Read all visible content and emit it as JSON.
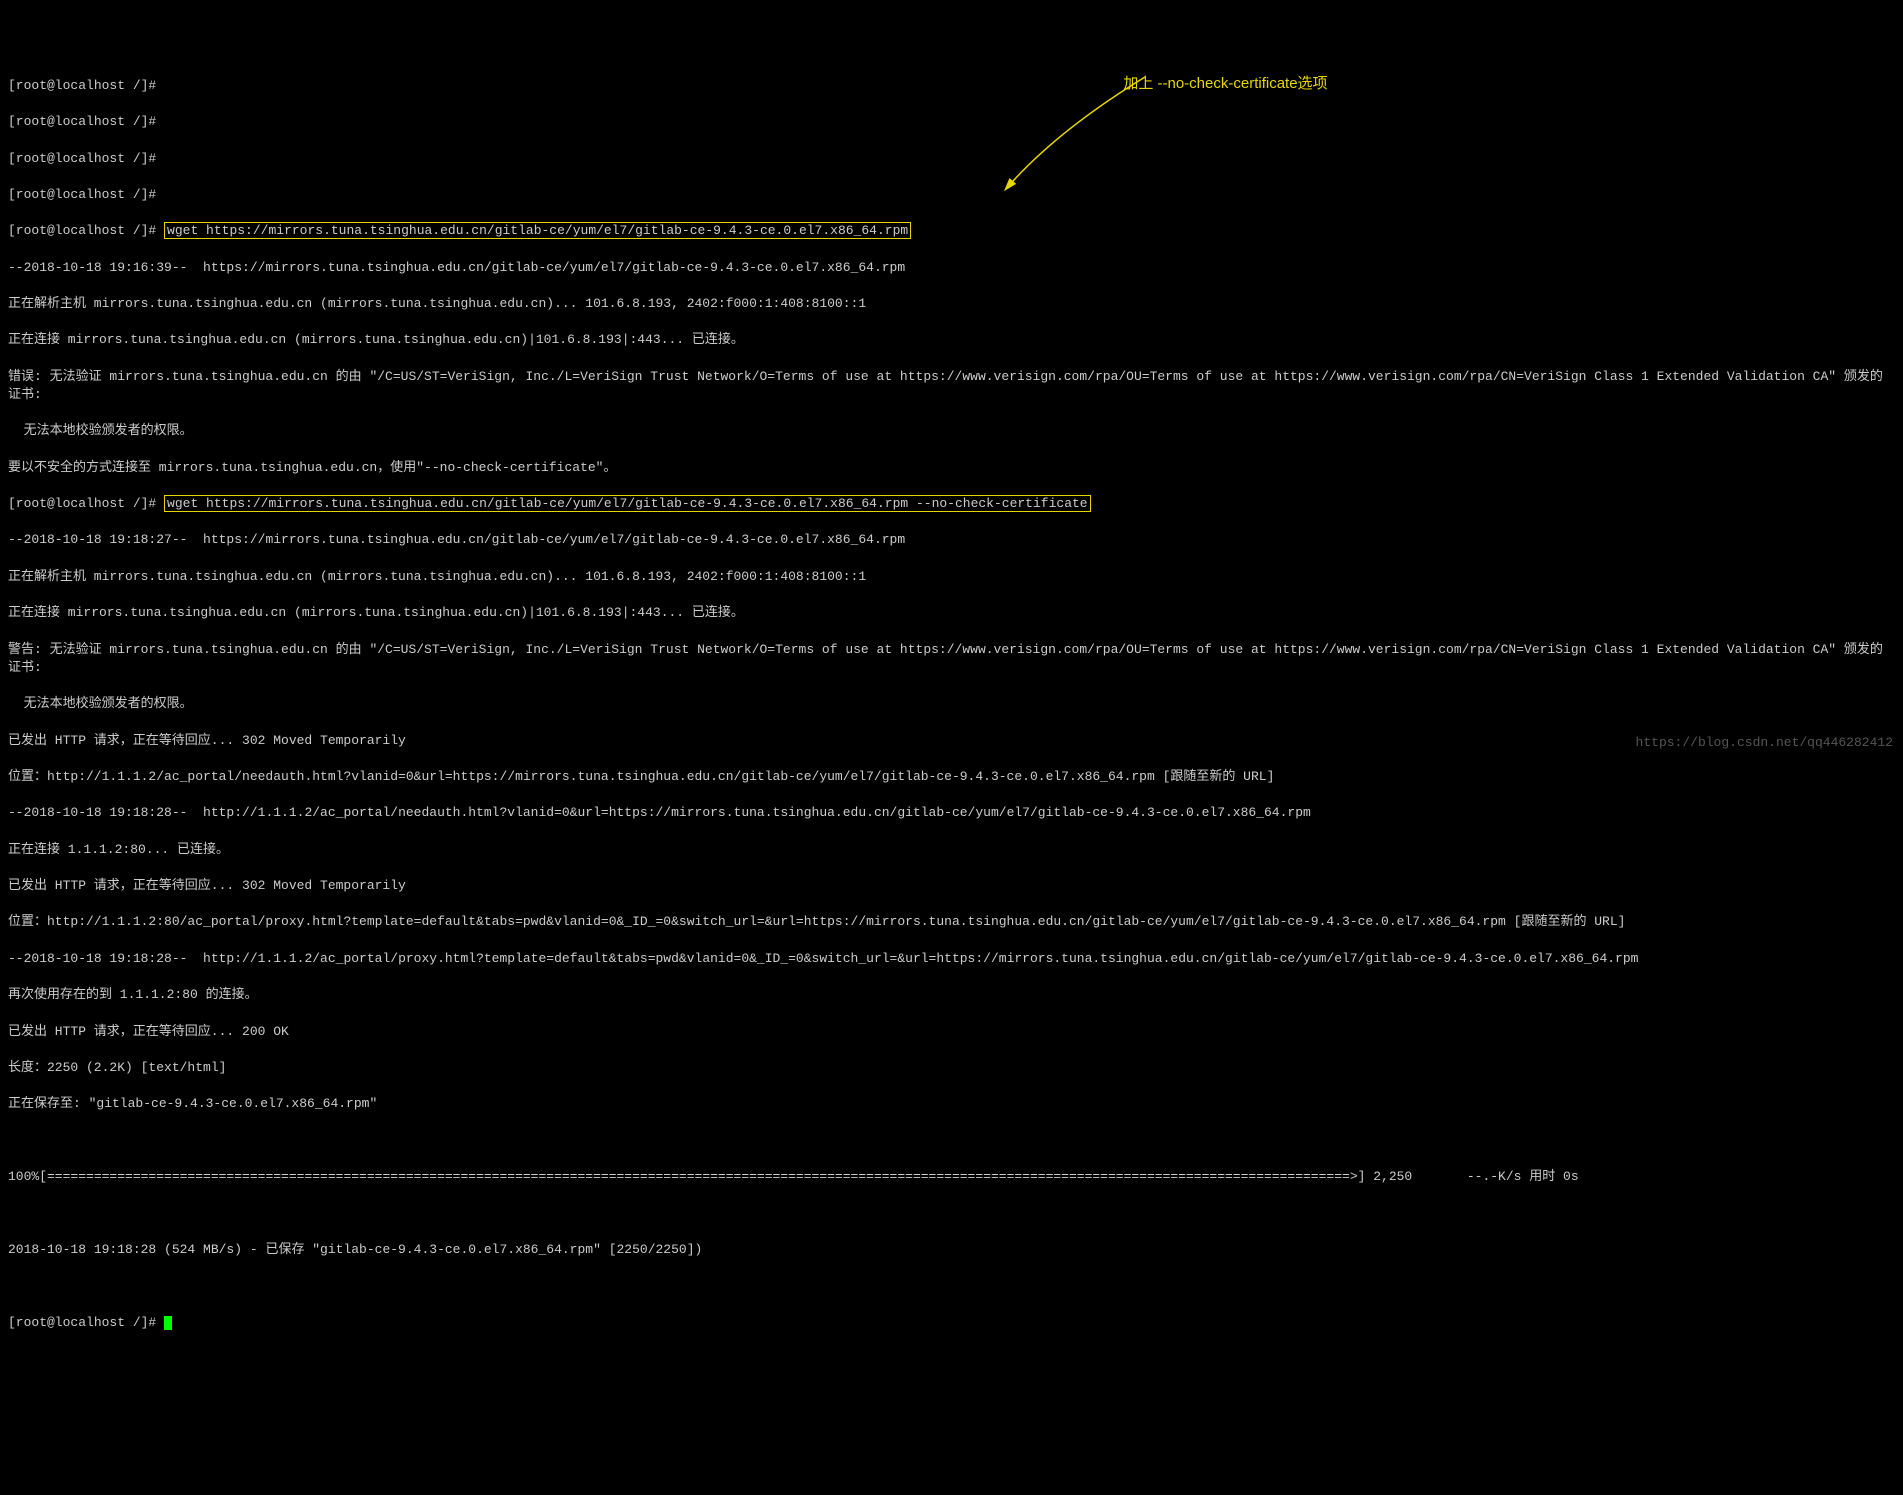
{
  "prompt": "[root@localhost /]#",
  "cmd1": "wget https://mirrors.tuna.tsinghua.edu.cn/gitlab-ce/yum/el7/gitlab-ce-9.4.3-ce.0.el7.x86_64.rpm",
  "cmd2": "wget https://mirrors.tuna.tsinghua.edu.cn/gitlab-ce/yum/el7/gitlab-ce-9.4.3-ce.0.el7.x86_64.rpm --no-check-certificate",
  "annotation_text": "加上 --no-check-certificate选项",
  "out": {
    "l1": "--2018-10-18 19:16:39--  https://mirrors.tuna.tsinghua.edu.cn/gitlab-ce/yum/el7/gitlab-ce-9.4.3-ce.0.el7.x86_64.rpm",
    "l2": "正在解析主机 mirrors.tuna.tsinghua.edu.cn (mirrors.tuna.tsinghua.edu.cn)... 101.6.8.193, 2402:f000:1:408:8100::1",
    "l3": "正在连接 mirrors.tuna.tsinghua.edu.cn (mirrors.tuna.tsinghua.edu.cn)|101.6.8.193|:443... 已连接。",
    "l4": "错误: 无法验证 mirrors.tuna.tsinghua.edu.cn 的由 \"/C=US/ST=VeriSign, Inc./L=VeriSign Trust Network/O=Terms of use at https://www.verisign.com/rpa/OU=Terms of use at https://www.verisign.com/rpa/CN=VeriSign Class 1 Extended Validation CA\" 颁发的证书:",
    "l5": "  无法本地校验颁发者的权限。",
    "l6": "要以不安全的方式连接至 mirrors.tuna.tsinghua.edu.cn，使用\"--no-check-certificate\"。",
    "l7": "--2018-10-18 19:18:27--  https://mirrors.tuna.tsinghua.edu.cn/gitlab-ce/yum/el7/gitlab-ce-9.4.3-ce.0.el7.x86_64.rpm",
    "l8": "正在解析主机 mirrors.tuna.tsinghua.edu.cn (mirrors.tuna.tsinghua.edu.cn)... 101.6.8.193, 2402:f000:1:408:8100::1",
    "l9": "正在连接 mirrors.tuna.tsinghua.edu.cn (mirrors.tuna.tsinghua.edu.cn)|101.6.8.193|:443... 已连接。",
    "l10": "警告: 无法验证 mirrors.tuna.tsinghua.edu.cn 的由 \"/C=US/ST=VeriSign, Inc./L=VeriSign Trust Network/O=Terms of use at https://www.verisign.com/rpa/OU=Terms of use at https://www.verisign.com/rpa/CN=VeriSign Class 1 Extended Validation CA\" 颁发的证书:",
    "l11": "  无法本地校验颁发者的权限。",
    "l12": "已发出 HTTP 请求，正在等待回应... 302 Moved Temporarily",
    "l13": "位置：http://1.1.1.2/ac_portal/needauth.html?vlanid=0&url=https://mirrors.tuna.tsinghua.edu.cn/gitlab-ce/yum/el7/gitlab-ce-9.4.3-ce.0.el7.x86_64.rpm [跟随至新的 URL]",
    "l14": "--2018-10-18 19:18:28--  http://1.1.1.2/ac_portal/needauth.html?vlanid=0&url=https://mirrors.tuna.tsinghua.edu.cn/gitlab-ce/yum/el7/gitlab-ce-9.4.3-ce.0.el7.x86_64.rpm",
    "l15": "正在连接 1.1.1.2:80... 已连接。",
    "l16": "已发出 HTTP 请求，正在等待回应... 302 Moved Temporarily",
    "l17": "位置：http://1.1.1.2:80/ac_portal/proxy.html?template=default&tabs=pwd&vlanid=0&_ID_=0&switch_url=&url=https://mirrors.tuna.tsinghua.edu.cn/gitlab-ce/yum/el7/gitlab-ce-9.4.3-ce.0.el7.x86_64.rpm [跟随至新的 URL]",
    "l18": "--2018-10-18 19:18:28--  http://1.1.1.2/ac_portal/proxy.html?template=default&tabs=pwd&vlanid=0&_ID_=0&switch_url=&url=https://mirrors.tuna.tsinghua.edu.cn/gitlab-ce/yum/el7/gitlab-ce-9.4.3-ce.0.el7.x86_64.rpm",
    "l19": "再次使用存在的到 1.1.1.2:80 的连接。",
    "l20": "已发出 HTTP 请求，正在等待回应... 200 OK",
    "l21": "长度：2250 (2.2K) [text/html]",
    "l22": "正在保存至: \"gitlab-ce-9.4.3-ce.0.el7.x86_64.rpm\"",
    "progress": "100%[=======================================================================================================================================================================>] 2,250       --.-K/s 用时 0s",
    "l23": "2018-10-18 19:18:28 (524 MB/s) - 已保存 \"gitlab-ce-9.4.3-ce.0.el7.x86_64.rpm\" [2250/2250])"
  },
  "watermark": "https://blog.csdn.net/qq446282412"
}
